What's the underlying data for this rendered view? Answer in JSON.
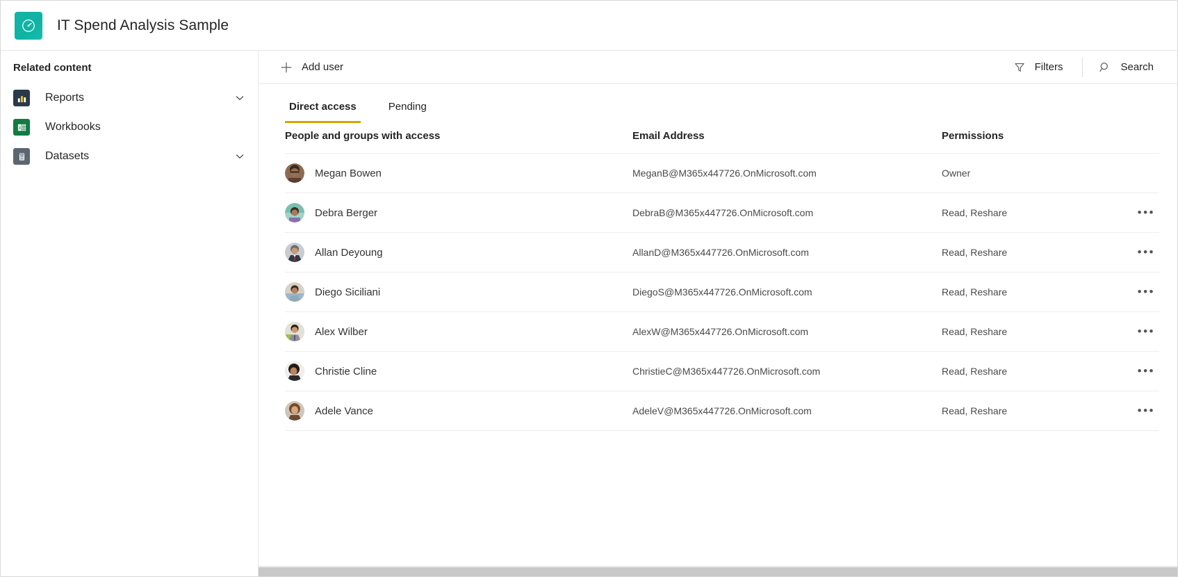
{
  "header": {
    "app_icon": "gauge-icon",
    "icon_color": "#13b5a6",
    "title": "IT Spend Analysis Sample"
  },
  "sidebar": {
    "heading": "Related content",
    "items": [
      {
        "label": "Reports",
        "icon": "bar-chart-icon",
        "icon_color": "#2b3a4a",
        "has_chevron": true
      },
      {
        "label": "Workbooks",
        "icon": "excel-grid-icon",
        "icon_color": "#107c41",
        "has_chevron": false
      },
      {
        "label": "Datasets",
        "icon": "database-icon",
        "icon_color": "#5c6670",
        "has_chevron": true
      }
    ]
  },
  "toolbar": {
    "add_user_label": "Add user",
    "add_user_icon": "plus-icon",
    "filters_label": "Filters",
    "filters_icon": "funnel-icon",
    "search_label": "Search",
    "search_icon": "search-icon"
  },
  "tabs": [
    {
      "label": "Direct access",
      "active": true,
      "underline_color": "#d8a402"
    },
    {
      "label": "Pending",
      "active": false,
      "underline_color": ""
    }
  ],
  "table": {
    "headers": {
      "people": "People and groups with access",
      "email": "Email Address",
      "permissions": "Permissions"
    },
    "rows": [
      {
        "name": "Megan Bowen",
        "email": "MeganB@M365x447726.OnMicrosoft.com",
        "permission": "Owner",
        "avatar": "avatar-megan-bowen",
        "has_menu": false
      },
      {
        "name": "Debra Berger",
        "email": "DebraB@M365x447726.OnMicrosoft.com",
        "permission": "Read, Reshare",
        "avatar": "avatar-debra-berger",
        "has_menu": true
      },
      {
        "name": "Allan Deyoung",
        "email": "AllanD@M365x447726.OnMicrosoft.com",
        "permission": "Read, Reshare",
        "avatar": "avatar-allan-deyoung",
        "has_menu": true
      },
      {
        "name": "Diego Siciliani",
        "email": "DiegoS@M365x447726.OnMicrosoft.com",
        "permission": "Read, Reshare",
        "avatar": "avatar-diego-siciliani",
        "has_menu": true
      },
      {
        "name": "Alex Wilber",
        "email": "AlexW@M365x447726.OnMicrosoft.com",
        "permission": "Read, Reshare",
        "avatar": "avatar-alex-wilber",
        "has_menu": true
      },
      {
        "name": "Christie Cline",
        "email": "ChristieC@M365x447726.OnMicrosoft.com",
        "permission": "Read, Reshare",
        "avatar": "avatar-christie-cline",
        "has_menu": true
      },
      {
        "name": "Adele Vance",
        "email": "AdeleV@M365x447726.OnMicrosoft.com",
        "permission": "Read, Reshare",
        "avatar": "avatar-adele-vance",
        "has_menu": true
      }
    ],
    "menu_glyph": "•••"
  }
}
